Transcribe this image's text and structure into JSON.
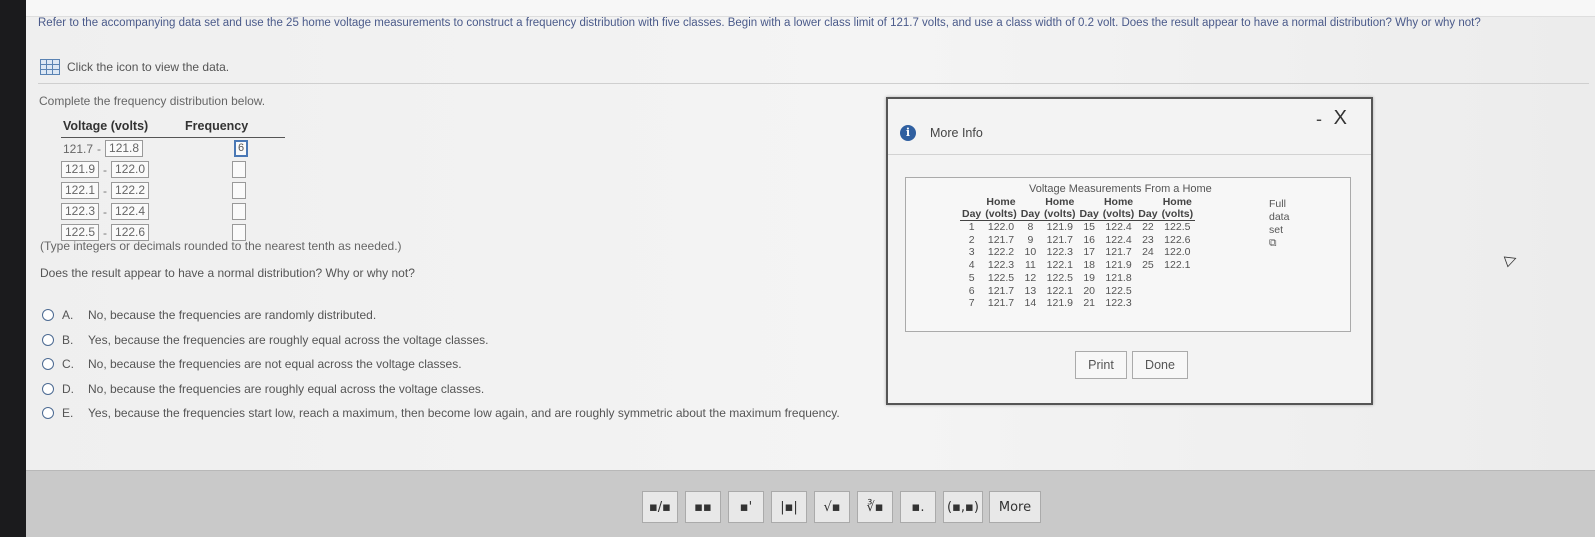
{
  "question": {
    "text": "Refer to the accompanying data set and use the 25 home voltage measurements to construct a frequency distribution with five classes. Begin with a lower class limit of 121.7 volts, and use a class width of 0.2 volt. Does the result appear to have a normal distribution? Why or why not?",
    "data_link": "Click the icon to view the data.",
    "instruction": "Complete the frequency distribution below."
  },
  "freq_table": {
    "col1": "Voltage (volts)",
    "col2": "Frequency",
    "rows": [
      {
        "lower": "121.7",
        "upper": "121.8",
        "freq": "6"
      },
      {
        "lower": "121.9",
        "upper": "122.0",
        "freq": ""
      },
      {
        "lower": "122.1",
        "upper": "122.2",
        "freq": ""
      },
      {
        "lower": "122.3",
        "upper": "122.4",
        "freq": ""
      },
      {
        "lower": "122.5",
        "upper": "122.6",
        "freq": ""
      }
    ],
    "dash": "-",
    "hint": "(Type integers or decimals rounded to the nearest tenth as needed.)"
  },
  "question2": "Does the result appear to have a normal distribution? Why or why not?",
  "options": [
    {
      "letter": "A.",
      "text": "No, because the frequencies are randomly distributed."
    },
    {
      "letter": "B.",
      "text": "Yes, because the frequencies are roughly equal across the voltage classes."
    },
    {
      "letter": "C.",
      "text": "No, because the frequencies are not equal across the voltage classes."
    },
    {
      "letter": "D.",
      "text": "No, because the frequencies are roughly equal across the voltage classes."
    },
    {
      "letter": "E.",
      "text": "Yes, because the frequencies start low, reach a maximum, then become low again, and are roughly symmetric about the maximum frequency."
    }
  ],
  "dialog": {
    "title": "More Info",
    "info_icon": "i",
    "minimize": "-",
    "close": "X",
    "caption": "Voltage Measurements From a Home",
    "head_top": [
      "Home",
      "Home",
      "Home",
      "Home"
    ],
    "head_units": [
      "Day",
      "(volts)",
      "Day",
      "(volts)",
      "Day",
      "(volts)",
      "Day",
      "(volts)"
    ],
    "rows": [
      [
        "1",
        "122.0",
        "8",
        "121.9",
        "15",
        "122.4",
        "22",
        "122.5"
      ],
      [
        "2",
        "121.7",
        "9",
        "121.7",
        "16",
        "122.4",
        "23",
        "122.6"
      ],
      [
        "3",
        "122.2",
        "10",
        "122.3",
        "17",
        "121.7",
        "24",
        "122.0"
      ],
      [
        "4",
        "122.3",
        "11",
        "122.1",
        "18",
        "121.9",
        "25",
        "122.1"
      ],
      [
        "5",
        "122.5",
        "12",
        "122.5",
        "19",
        "121.8",
        "",
        ""
      ],
      [
        "6",
        "121.7",
        "13",
        "122.1",
        "20",
        "122.5",
        "",
        ""
      ],
      [
        "7",
        "121.7",
        "14",
        "121.9",
        "21",
        "122.3",
        "",
        ""
      ]
    ],
    "full_data_1": "Full",
    "full_data_2": "data",
    "full_data_3": "set",
    "print": "Print",
    "done": "Done"
  },
  "toolbar": {
    "buttons": [
      "▪/▪",
      "▪▪",
      "▪'",
      "|▪|",
      "√▪",
      "∛▪",
      "▪.",
      "(▪,▪)"
    ],
    "more": "More"
  }
}
